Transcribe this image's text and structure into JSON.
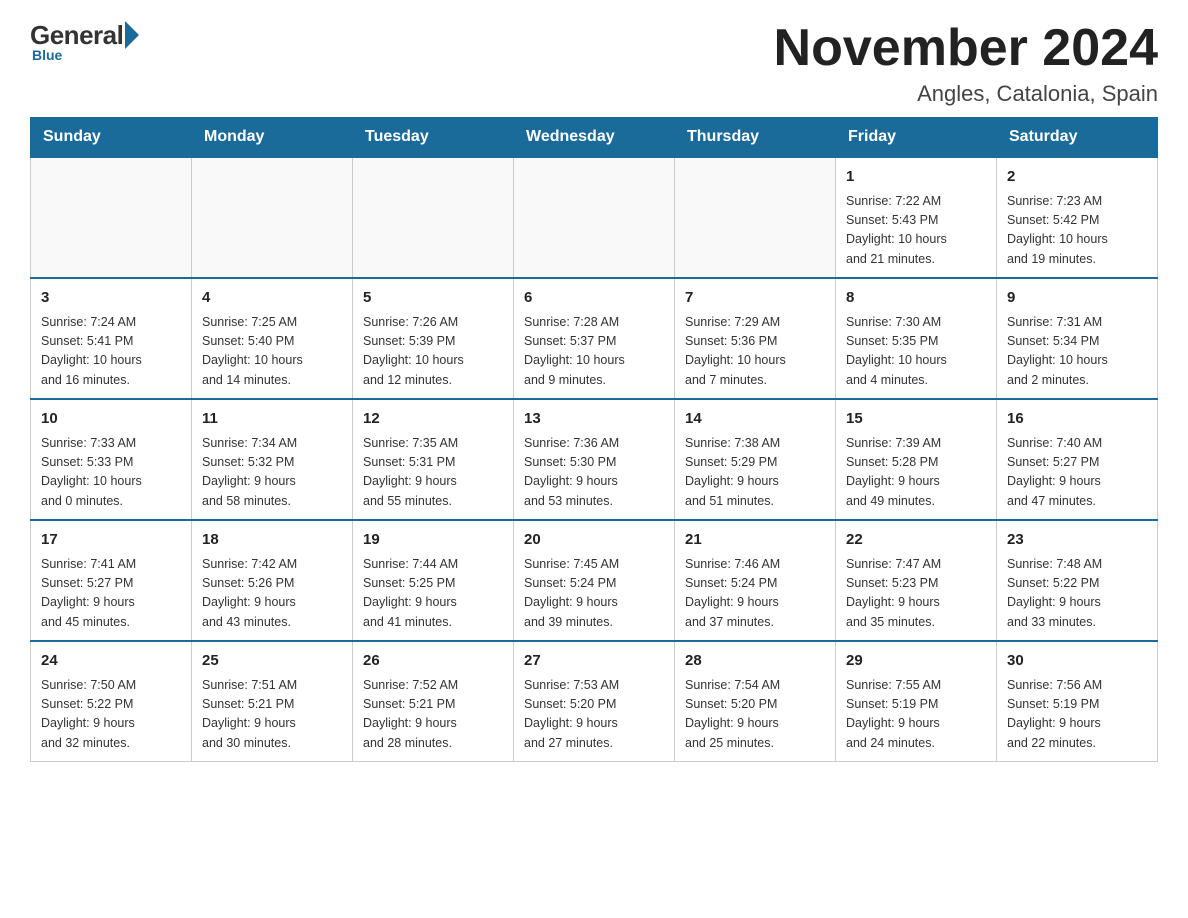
{
  "header": {
    "logo": {
      "general": "General",
      "blue": "Blue",
      "tagline": "Blue"
    },
    "title": "November 2024",
    "location": "Angles, Catalonia, Spain"
  },
  "weekdays": [
    "Sunday",
    "Monday",
    "Tuesday",
    "Wednesday",
    "Thursday",
    "Friday",
    "Saturday"
  ],
  "weeks": [
    [
      {
        "day": "",
        "info": ""
      },
      {
        "day": "",
        "info": ""
      },
      {
        "day": "",
        "info": ""
      },
      {
        "day": "",
        "info": ""
      },
      {
        "day": "",
        "info": ""
      },
      {
        "day": "1",
        "info": "Sunrise: 7:22 AM\nSunset: 5:43 PM\nDaylight: 10 hours\nand 21 minutes."
      },
      {
        "day": "2",
        "info": "Sunrise: 7:23 AM\nSunset: 5:42 PM\nDaylight: 10 hours\nand 19 minutes."
      }
    ],
    [
      {
        "day": "3",
        "info": "Sunrise: 7:24 AM\nSunset: 5:41 PM\nDaylight: 10 hours\nand 16 minutes."
      },
      {
        "day": "4",
        "info": "Sunrise: 7:25 AM\nSunset: 5:40 PM\nDaylight: 10 hours\nand 14 minutes."
      },
      {
        "day": "5",
        "info": "Sunrise: 7:26 AM\nSunset: 5:39 PM\nDaylight: 10 hours\nand 12 minutes."
      },
      {
        "day": "6",
        "info": "Sunrise: 7:28 AM\nSunset: 5:37 PM\nDaylight: 10 hours\nand 9 minutes."
      },
      {
        "day": "7",
        "info": "Sunrise: 7:29 AM\nSunset: 5:36 PM\nDaylight: 10 hours\nand 7 minutes."
      },
      {
        "day": "8",
        "info": "Sunrise: 7:30 AM\nSunset: 5:35 PM\nDaylight: 10 hours\nand 4 minutes."
      },
      {
        "day": "9",
        "info": "Sunrise: 7:31 AM\nSunset: 5:34 PM\nDaylight: 10 hours\nand 2 minutes."
      }
    ],
    [
      {
        "day": "10",
        "info": "Sunrise: 7:33 AM\nSunset: 5:33 PM\nDaylight: 10 hours\nand 0 minutes."
      },
      {
        "day": "11",
        "info": "Sunrise: 7:34 AM\nSunset: 5:32 PM\nDaylight: 9 hours\nand 58 minutes."
      },
      {
        "day": "12",
        "info": "Sunrise: 7:35 AM\nSunset: 5:31 PM\nDaylight: 9 hours\nand 55 minutes."
      },
      {
        "day": "13",
        "info": "Sunrise: 7:36 AM\nSunset: 5:30 PM\nDaylight: 9 hours\nand 53 minutes."
      },
      {
        "day": "14",
        "info": "Sunrise: 7:38 AM\nSunset: 5:29 PM\nDaylight: 9 hours\nand 51 minutes."
      },
      {
        "day": "15",
        "info": "Sunrise: 7:39 AM\nSunset: 5:28 PM\nDaylight: 9 hours\nand 49 minutes."
      },
      {
        "day": "16",
        "info": "Sunrise: 7:40 AM\nSunset: 5:27 PM\nDaylight: 9 hours\nand 47 minutes."
      }
    ],
    [
      {
        "day": "17",
        "info": "Sunrise: 7:41 AM\nSunset: 5:27 PM\nDaylight: 9 hours\nand 45 minutes."
      },
      {
        "day": "18",
        "info": "Sunrise: 7:42 AM\nSunset: 5:26 PM\nDaylight: 9 hours\nand 43 minutes."
      },
      {
        "day": "19",
        "info": "Sunrise: 7:44 AM\nSunset: 5:25 PM\nDaylight: 9 hours\nand 41 minutes."
      },
      {
        "day": "20",
        "info": "Sunrise: 7:45 AM\nSunset: 5:24 PM\nDaylight: 9 hours\nand 39 minutes."
      },
      {
        "day": "21",
        "info": "Sunrise: 7:46 AM\nSunset: 5:24 PM\nDaylight: 9 hours\nand 37 minutes."
      },
      {
        "day": "22",
        "info": "Sunrise: 7:47 AM\nSunset: 5:23 PM\nDaylight: 9 hours\nand 35 minutes."
      },
      {
        "day": "23",
        "info": "Sunrise: 7:48 AM\nSunset: 5:22 PM\nDaylight: 9 hours\nand 33 minutes."
      }
    ],
    [
      {
        "day": "24",
        "info": "Sunrise: 7:50 AM\nSunset: 5:22 PM\nDaylight: 9 hours\nand 32 minutes."
      },
      {
        "day": "25",
        "info": "Sunrise: 7:51 AM\nSunset: 5:21 PM\nDaylight: 9 hours\nand 30 minutes."
      },
      {
        "day": "26",
        "info": "Sunrise: 7:52 AM\nSunset: 5:21 PM\nDaylight: 9 hours\nand 28 minutes."
      },
      {
        "day": "27",
        "info": "Sunrise: 7:53 AM\nSunset: 5:20 PM\nDaylight: 9 hours\nand 27 minutes."
      },
      {
        "day": "28",
        "info": "Sunrise: 7:54 AM\nSunset: 5:20 PM\nDaylight: 9 hours\nand 25 minutes."
      },
      {
        "day": "29",
        "info": "Sunrise: 7:55 AM\nSunset: 5:19 PM\nDaylight: 9 hours\nand 24 minutes."
      },
      {
        "day": "30",
        "info": "Sunrise: 7:56 AM\nSunset: 5:19 PM\nDaylight: 9 hours\nand 22 minutes."
      }
    ]
  ]
}
